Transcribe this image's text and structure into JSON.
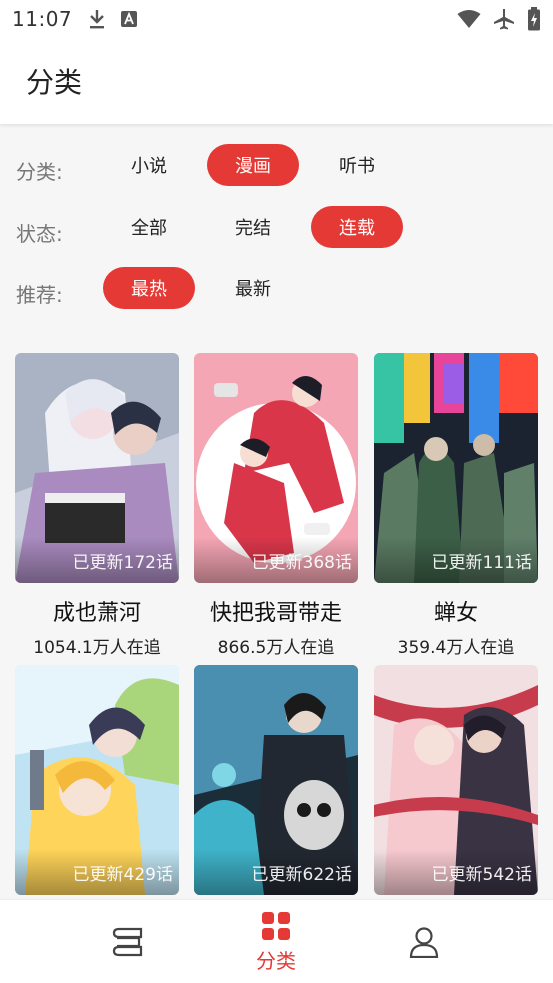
{
  "status_bar": {
    "time": "11:07",
    "icons": [
      "download-icon",
      "keyboard-a-icon",
      "wifi-icon",
      "airplane-icon",
      "battery-charging-icon"
    ]
  },
  "app_bar": {
    "title": "分类"
  },
  "filters": {
    "category": {
      "label": "分类:",
      "options": [
        "小说",
        "漫画",
        "听书"
      ],
      "selected": "漫画"
    },
    "status": {
      "label": "状态:",
      "options": [
        "全部",
        "完结",
        "连载"
      ],
      "selected": "连载"
    },
    "recommend": {
      "label": "推荐:",
      "options": [
        "最热",
        "最新"
      ],
      "selected": "最热"
    }
  },
  "comics": [
    {
      "update": "已更新172话",
      "title": "成也萧河",
      "followers": "1054.1万人在追"
    },
    {
      "update": "已更新368话",
      "title": "快把我哥带走",
      "followers": "866.5万人在追"
    },
    {
      "update": "已更新111话",
      "title": "蝉女",
      "followers": "359.4万人在追"
    },
    {
      "update": "已更新429话",
      "title": "",
      "followers": ""
    },
    {
      "update": "已更新622话",
      "title": "",
      "followers": ""
    },
    {
      "update": "已更新542话",
      "title": "",
      "followers": ""
    }
  ],
  "bottom_nav": {
    "items": [
      {
        "icon": "bookshelf-icon",
        "label": ""
      },
      {
        "icon": "category-grid-icon",
        "label": "分类"
      },
      {
        "icon": "user-profile-icon",
        "label": ""
      }
    ],
    "active": "分类"
  },
  "colors": {
    "accent": "#e53935",
    "background": "#f6f6f7"
  }
}
